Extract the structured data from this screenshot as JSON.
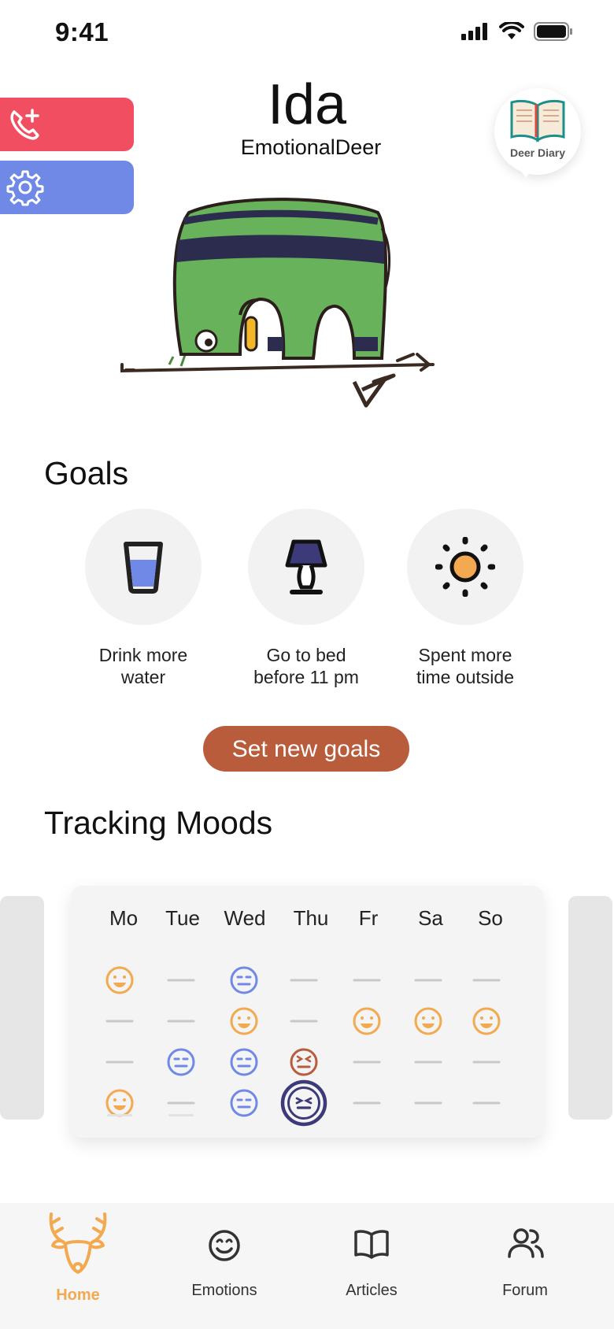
{
  "status_bar": {
    "time": "9:41"
  },
  "side_buttons": {
    "call": "phone-plus-icon",
    "settings": "gear-icon"
  },
  "profile": {
    "name": "Ida",
    "username": "EmotionalDeer"
  },
  "diary": {
    "label": "Deer Diary"
  },
  "goals": {
    "title": "Goals",
    "items": [
      {
        "icon": "water-glass-icon",
        "label": "Drink more\nwater"
      },
      {
        "icon": "lamp-icon",
        "label": "Go to bed\nbefore 11 pm"
      },
      {
        "icon": "sun-icon",
        "label": "Spent more\ntime outside"
      }
    ],
    "button_label": "Set new goals"
  },
  "moods": {
    "title": "Tracking Moods",
    "days": [
      "Mo",
      "Tue",
      "Wed",
      "Thu",
      "Fr",
      "Sa",
      "So"
    ],
    "colors": {
      "happy": "#f2a950",
      "neutral": "#7088e6",
      "angry": "#b85c3c",
      "selected": "#3d3a7a"
    },
    "grid": [
      [
        "happy",
        "none",
        "neutral",
        "none",
        "none",
        "none",
        "none"
      ],
      [
        "none",
        "none",
        "happy",
        "none",
        "happy",
        "happy",
        "happy"
      ],
      [
        "none",
        "neutral",
        "neutral",
        "angry",
        "none",
        "none",
        "none"
      ],
      [
        "happy",
        "none",
        "neutral",
        "selected",
        "none",
        "none",
        "none"
      ]
    ]
  },
  "nav": {
    "items": [
      {
        "label": "Home",
        "icon": "deer-icon",
        "active": true
      },
      {
        "label": "Emotions",
        "icon": "smiley-icon",
        "active": false
      },
      {
        "label": "Articles",
        "icon": "book-icon",
        "active": false
      },
      {
        "label": "Forum",
        "icon": "people-icon",
        "active": false
      }
    ],
    "active_color": "#f2a950"
  }
}
